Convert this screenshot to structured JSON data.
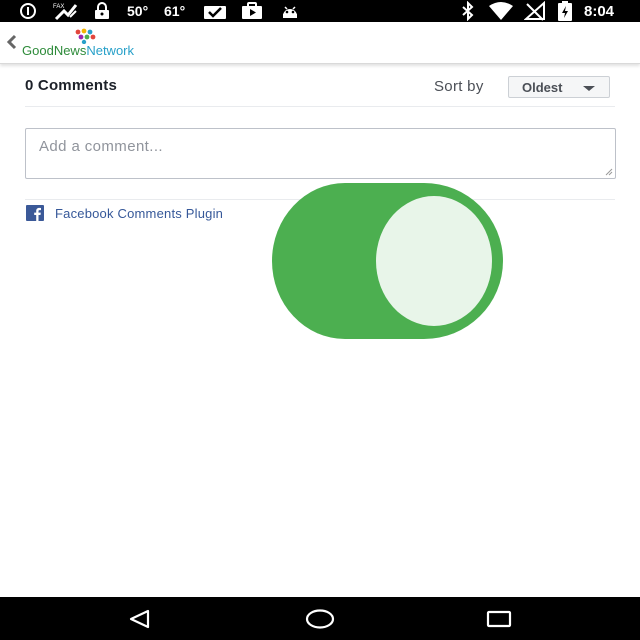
{
  "status_bar": {
    "temp_1": "50°",
    "temp_2": "61°",
    "time": "8:04",
    "icons": [
      "info-icon",
      "no-sim-fax-icon",
      "lock-icon",
      "photo-check-icon",
      "play-store-icon",
      "android-icon",
      "bluetooth-icon",
      "wifi-icon",
      "no-signal-icon",
      "battery-charging-icon"
    ]
  },
  "header": {
    "logo_good": "Good",
    "logo_news": "News",
    "logo_network": "Network",
    "logo_colors": [
      "#e2463c",
      "#f4b400",
      "#4caf50",
      "#27a0c9",
      "#9c27b0"
    ]
  },
  "comments": {
    "count_label": "0 Comments",
    "sort_label": "Sort by",
    "sort_value": "Oldest",
    "input_placeholder": "Add a comment...",
    "plugin_label": "Facebook Comments Plugin"
  },
  "toggle": {
    "state": "on",
    "track_color": "#4caf50",
    "knob_color": "#e8f5e9"
  },
  "nav_bar": {
    "buttons": [
      "back-icon",
      "home-icon",
      "recents-icon"
    ]
  },
  "colors": {
    "fb_link": "#365899",
    "text_dark": "#1d2129",
    "text_muted": "#90949c"
  }
}
